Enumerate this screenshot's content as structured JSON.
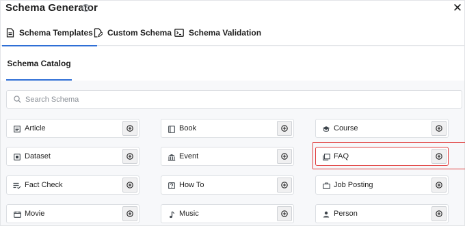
{
  "header": {
    "title": "Schema Generator",
    "help_icon": "question-circle-icon",
    "close_icon": "close-icon"
  },
  "tabs": [
    {
      "label": "Schema Templates",
      "icon": "document-icon",
      "active": true
    },
    {
      "label": "Custom Schema",
      "icon": "edit-document-icon",
      "active": false
    },
    {
      "label": "Schema Validation",
      "icon": "terminal-icon",
      "active": false
    }
  ],
  "subtab": {
    "label": "Schema Catalog"
  },
  "search": {
    "placeholder": "Search Schema",
    "value": ""
  },
  "catalog": [
    {
      "label": "Article",
      "icon": "article-icon"
    },
    {
      "label": "Book",
      "icon": "book-icon"
    },
    {
      "label": "Course",
      "icon": "graduation-cap-icon"
    },
    {
      "label": "Dataset",
      "icon": "dataset-icon"
    },
    {
      "label": "Event",
      "icon": "event-icon"
    },
    {
      "label": "FAQ",
      "icon": "faq-icon",
      "highlighted": true
    },
    {
      "label": "Fact Check",
      "icon": "fact-check-icon"
    },
    {
      "label": "How To",
      "icon": "howto-icon"
    },
    {
      "label": "Job Posting",
      "icon": "briefcase-icon"
    },
    {
      "label": "Movie",
      "icon": "movie-icon"
    },
    {
      "label": "Music",
      "icon": "music-note-icon"
    },
    {
      "label": "Person",
      "icon": "person-icon"
    }
  ],
  "colors": {
    "accent": "#2f6fd6",
    "highlight": "#e03b3b",
    "background": "#f7f8fa"
  }
}
